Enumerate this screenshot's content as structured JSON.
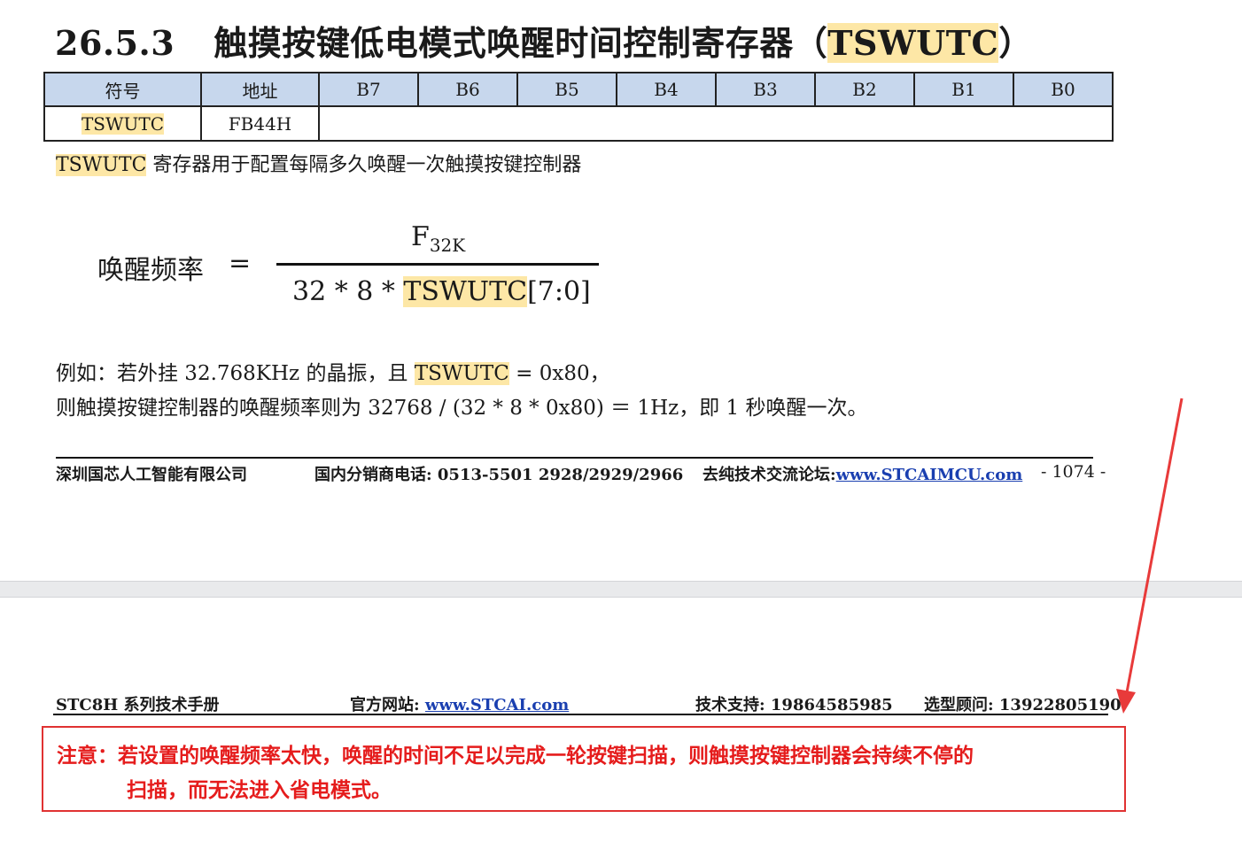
{
  "section": {
    "number": "26.5.3",
    "title_prefix": "触摸按键低电模式唤醒时间控制寄存器（",
    "title_reg": "TSWUTC",
    "title_suffix": "）"
  },
  "register_table": {
    "headers": [
      "符号",
      "地址",
      "B7",
      "B6",
      "B5",
      "B4",
      "B3",
      "B2",
      "B1",
      "B0"
    ],
    "row": {
      "symbol": "TSWUTC",
      "address": "FB44H"
    }
  },
  "description": {
    "reg": "TSWUTC",
    "text": " 寄存器用于配置每隔多久唤醒一次触摸按键控制器"
  },
  "formula": {
    "label": "唤醒频率",
    "equals": "=",
    "numerator_base": "F",
    "numerator_sub": "32K",
    "denominator_prefix": "32 * 8 * ",
    "denominator_reg": "TSWUTC",
    "denominator_suffix": "[7:0]"
  },
  "example": {
    "line1_prefix": "例如：若外挂 32.768KHz 的晶振，且 ",
    "line1_reg": "TSWUTC",
    "line1_suffix": " = 0x80，",
    "line2": "则触摸按键控制器的唤醒频率则为 32768 / (32 * 8 * 0x80)  ＝ 1Hz，即 1 秒唤醒一次。"
  },
  "footer_page1": {
    "company": "深圳国芯人工智能有限公司",
    "phone": "国内分销商电话: 0513-5501 2928/2929/2966",
    "forum_label": "去纯技术交流论坛:",
    "forum_url": "www.STCAIMCU.com",
    "page_number": "- 1074 -"
  },
  "footer_page2": {
    "manual": "STC8H 系列技术手册",
    "website_label": "官方网站: ",
    "website_url": "www.STCAI.com",
    "support": "技术支持: 19864585985",
    "advisor": "选型顾问: 13922805190"
  },
  "note": {
    "line1": "注意：若设置的唤醒频率太快，唤醒的时间不足以完成一轮按键扫描，则触摸按键控制器会持续不停的",
    "line2": "扫描，而无法进入省电模式。"
  },
  "colors": {
    "highlight": "#fde7a6",
    "table_header": "#c7d7ed",
    "note_red": "#e51c1c",
    "link_blue": "#1a3fb0"
  }
}
